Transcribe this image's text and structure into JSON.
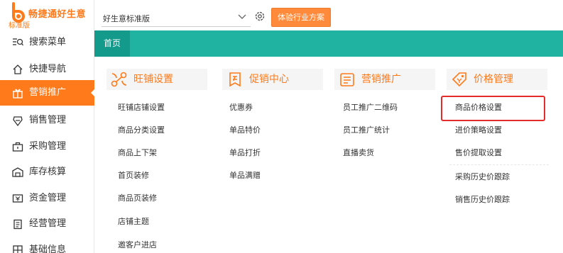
{
  "app": {
    "logo_name": "畅捷通好生意",
    "edition": "标准版"
  },
  "sidebar": {
    "items": [
      {
        "label": "搜索菜单",
        "icon": "search-menu-icon"
      },
      {
        "label": "快捷导航",
        "icon": "home-icon"
      },
      {
        "label": "营销推广",
        "icon": "gift-icon"
      },
      {
        "label": "销售管理",
        "icon": "sales-icon"
      },
      {
        "label": "采购管理",
        "icon": "briefcase-icon"
      },
      {
        "label": "库存核算",
        "icon": "warehouse-icon"
      },
      {
        "label": "资金管理",
        "icon": "money-icon"
      },
      {
        "label": "经营管理",
        "icon": "clipboard-icon"
      },
      {
        "label": "基础信息",
        "icon": "grid-icon"
      }
    ],
    "active_index": 2
  },
  "topbar": {
    "product_select_value": "好生意标准版",
    "cta_label": "体验行业方案"
  },
  "tabs": [
    {
      "label": "首页"
    }
  ],
  "menu": {
    "columns": [
      {
        "title": "旺铺设置",
        "icon": "scissors-tools-icon",
        "items": [
          "旺铺店铺设置",
          "商品分类设置",
          "商品上下架",
          "首页装修",
          "商品页装修",
          "店铺主题",
          "邀客户进店"
        ]
      },
      {
        "title": "促销中心",
        "icon": "promo-tag-icon",
        "items": [
          "优惠券",
          "单品特价",
          "单品打折",
          "单品满赠"
        ]
      },
      {
        "title": "营销推广",
        "icon": "megaphone-icon",
        "items": [
          "员工推广二维码",
          "员工推广统计",
          "直播卖货"
        ]
      },
      {
        "title": "价格管理",
        "icon": "price-tag-icon",
        "items": [
          "商品价格设置",
          "进价策略设置",
          "售价提取设置",
          "采购历史价跟踪",
          "销售历史价跟踪"
        ]
      }
    ]
  },
  "colors": {
    "accent": "#ff7a1a",
    "tabbar": "#21b3a2",
    "highlight": "#e52b2b"
  }
}
